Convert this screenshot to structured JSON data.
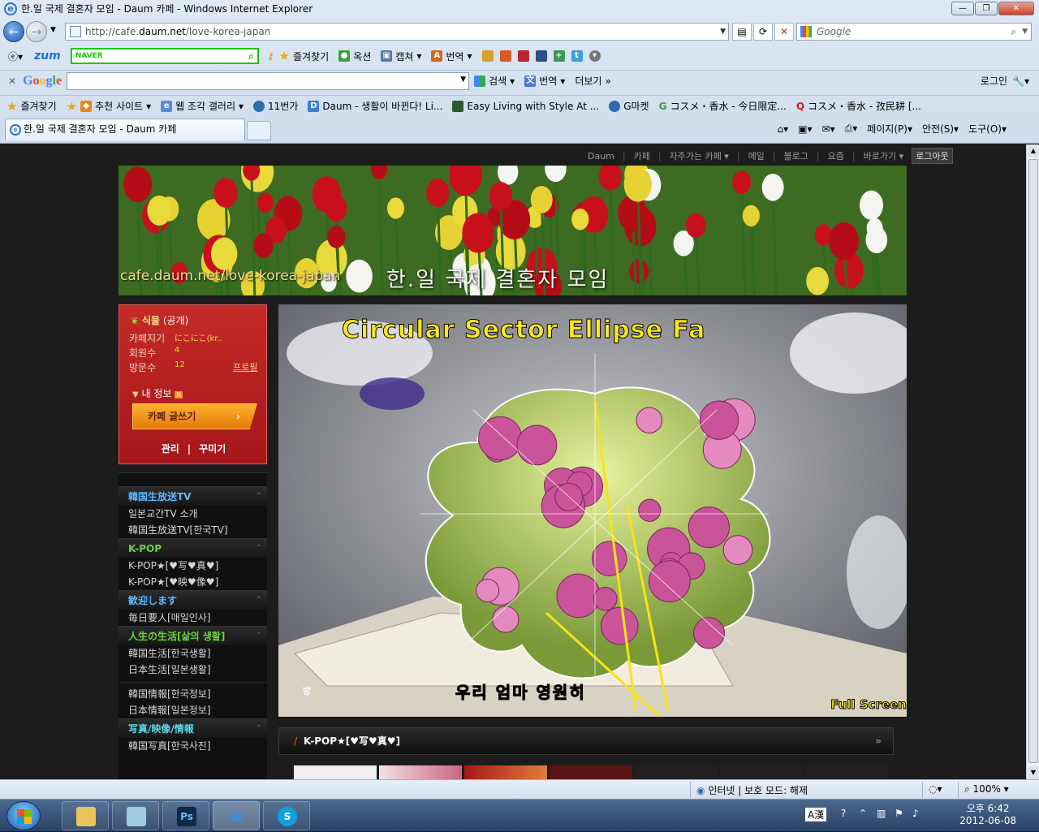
{
  "window": {
    "title": "한.일 국제 결혼자 모임 - Daum 카페 - Windows Internet Explorer",
    "min": "—",
    "max": "❐",
    "close": "✕"
  },
  "nav": {
    "url_prefix": "http://cafe.",
    "url_host": "daum.net",
    "url_path": "/love-korea-japan",
    "search_placeholder": "Google"
  },
  "toolbar1": {
    "zum": "zum",
    "naver": "NAVER",
    "items": [
      "즐겨찾기",
      "옥션",
      "캡쳐",
      "번역"
    ]
  },
  "toolbar2": {
    "search": "검색",
    "translate": "번역",
    "more": "더보기",
    "login": "로그인"
  },
  "favorites": {
    "label": "즐겨찾기",
    "items": [
      "추천 사이트",
      "웹 조각 갤러리",
      "11번가",
      "Daum - 생활이 바뀐다! Li...",
      "Easy Living with Style At ...",
      "G마켓",
      "コスメ・香水 - 今日限定...",
      "コスメ・香水 - 孜民耕 [..."
    ]
  },
  "tab": {
    "label": "한.일 국제 결혼자 모임 - Daum 카페"
  },
  "command_bar": [
    "페이지(P)",
    "안전(S)",
    "도구(O)"
  ],
  "gnb": {
    "items": [
      "Daum",
      "카페",
      "자주가는 카페",
      "메일",
      "블로그",
      "요즘",
      "바로가기"
    ],
    "logout": "로그아웃"
  },
  "banner": {
    "url": "cafe.daum.net/love-korea-japan",
    "title": "한.일 국제 결혼자 모임"
  },
  "profile": {
    "level": "식물",
    "visibility": "(공개)",
    "rows": [
      {
        "label": "카페지기",
        "value": "にこにこ(kr.."
      },
      {
        "label": "회원수",
        "value": "4"
      },
      {
        "label": "방문수",
        "value": "12"
      }
    ],
    "profile_link": "프로필",
    "my_info": "내 정보",
    "write": "카페 글쓰기",
    "manage": "관리",
    "decorate": "꾸미기"
  },
  "menu": {
    "groups": [
      {
        "title": "韓国生放送TV",
        "items": [
          "일본교간TV 소개",
          "韓国生放送TV[한국TV]"
        ]
      },
      {
        "title": "K-POP",
        "items": [
          "K-POP★[♥写♥真♥]",
          "K-POP★[♥映♥像♥]"
        ]
      },
      {
        "title": "歓迎します",
        "items": [
          "毎日要人[매일인사]"
        ]
      },
      {
        "title": "人生の生活[삶의 생활]",
        "items": [
          "韓国生活[한국생활]",
          "日本生活[일본생활]"
        ]
      },
      {
        "title": "",
        "items": [
          "韓国情報[한국정보]",
          "日本情報[일본정보]"
        ]
      },
      {
        "title": "写真/映像/情報",
        "items": [
          "韓国写真[한국사진]"
        ]
      }
    ]
  },
  "hero": {
    "title": "Circular Sector Ellipse Fa",
    "caption": "우리 엄마 영원히",
    "fullscreen": "Full Screen",
    "tag": "방"
  },
  "kpop_board": {
    "title": "K-POP★[♥写♥真♥]",
    "more": "»"
  },
  "statusbar": {
    "zone": "인터넷 | 보호 모드: 해제",
    "zoom": "100%"
  },
  "taskbar": {
    "time": "오후 6:42",
    "date": "2012-06-08",
    "ime": "A漢",
    "apps": [
      "Ps",
      "e",
      "S"
    ]
  },
  "colors": {
    "accent_red": "#c42a26",
    "write_orange": "#f39a1a",
    "caption_yellow": "#ffe81c"
  }
}
